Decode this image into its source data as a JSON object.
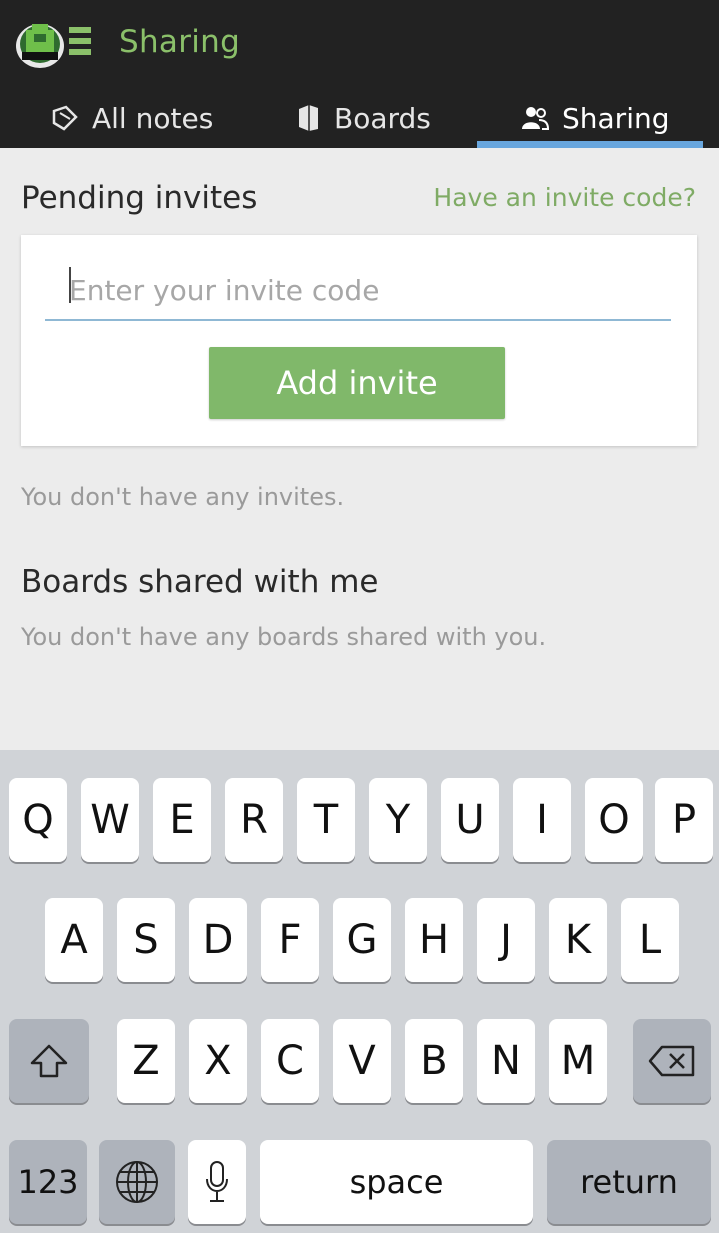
{
  "header": {
    "title": "Sharing",
    "logo_icon": "turtle-logo-icon"
  },
  "tabs": [
    {
      "label": "All notes",
      "icon": "notes-icon",
      "active": false
    },
    {
      "label": "Boards",
      "icon": "boards-icon",
      "active": false
    },
    {
      "label": "Sharing",
      "icon": "users-icon",
      "active": true
    }
  ],
  "pending": {
    "title": "Pending invites",
    "invite_link": "Have an invite code?",
    "input_placeholder": "Enter your invite code",
    "input_value": "",
    "add_button": "Add invite",
    "empty_text": "You don't have any invites."
  },
  "shared": {
    "title": "Boards shared with me",
    "empty_text": "You don't have any boards shared with you."
  },
  "keyboard": {
    "row1": [
      "Q",
      "W",
      "E",
      "R",
      "T",
      "Y",
      "U",
      "I",
      "O",
      "P"
    ],
    "row2": [
      "A",
      "S",
      "D",
      "F",
      "G",
      "H",
      "J",
      "K",
      "L"
    ],
    "row3": [
      "Z",
      "X",
      "C",
      "V",
      "B",
      "N",
      "M"
    ],
    "numbers_label": "123",
    "space_label": "space",
    "return_label": "return"
  },
  "colors": {
    "accent_green": "#80b86a",
    "tab_underline": "#68a6dd",
    "topbar": "#222222"
  }
}
